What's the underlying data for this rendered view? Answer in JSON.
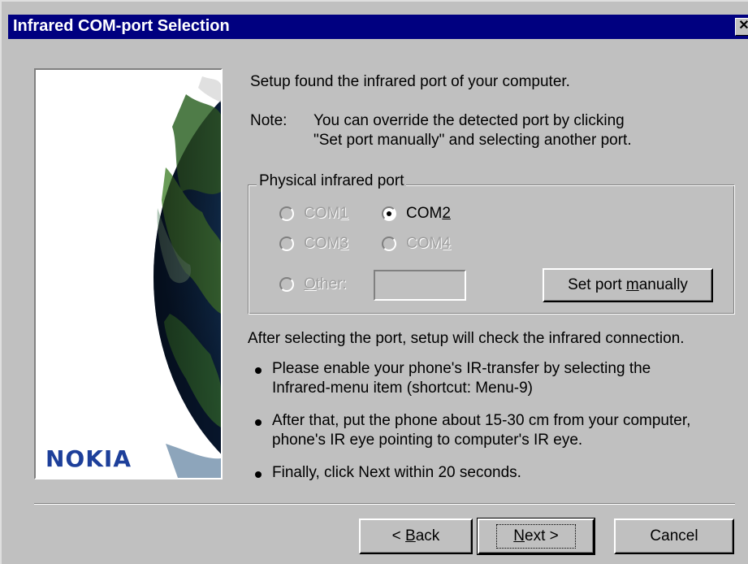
{
  "window": {
    "title": "Infrared COM-port Selection",
    "close_glyph": "✕"
  },
  "banner": {
    "logo_text": "NOKIA",
    "logo_color": "#1d3f9a",
    "image": "earth-globe"
  },
  "intro": {
    "line": "Setup found the infrared port of your computer.",
    "note_label": "Note:",
    "note_line1": "You can override the detected port by clicking",
    "note_line2": "\"Set port manually\" and selecting another port."
  },
  "group": {
    "legend": "Physical infrared port",
    "options": [
      {
        "label_pre": "COM",
        "label_ul": "1",
        "label_post": "",
        "selected": false,
        "enabled": false
      },
      {
        "label_pre": "COM",
        "label_ul": "2",
        "label_post": "",
        "selected": true,
        "enabled": true
      },
      {
        "label_pre": "COM",
        "label_ul": "3",
        "label_post": "",
        "selected": false,
        "enabled": false
      },
      {
        "label_pre": "COM",
        "label_ul": "4",
        "label_post": "",
        "selected": false,
        "enabled": false
      },
      {
        "label_pre": "",
        "label_ul": "O",
        "label_post": "ther:",
        "selected": false,
        "enabled": false
      }
    ],
    "other_value": "",
    "set_manual_button": {
      "pre": "Set port ",
      "ul": "m",
      "post": "anually"
    }
  },
  "instructions": {
    "lead": "After selecting the port, setup will check the infrared connection.",
    "bullets": [
      {
        "line1": "Please enable your phone's IR-transfer by selecting the",
        "line2": "Infrared-menu item (shortcut: Menu-9)"
      },
      {
        "line1": "After that, put the phone about 15-30 cm from your computer,",
        "line2": "phone's IR eye pointing to computer's IR eye."
      },
      {
        "line1": "Finally, click Next within 20 seconds.",
        "line2": ""
      }
    ]
  },
  "buttons": {
    "back": {
      "pre": "< ",
      "ul": "B",
      "post": "ack"
    },
    "next": {
      "pre": "",
      "ul": "N",
      "post": "ext >"
    },
    "cancel": "Cancel"
  },
  "colors": {
    "title_bar": "#000080",
    "face": "#c0c0c0",
    "disabled_text": "#a0a0a0"
  }
}
